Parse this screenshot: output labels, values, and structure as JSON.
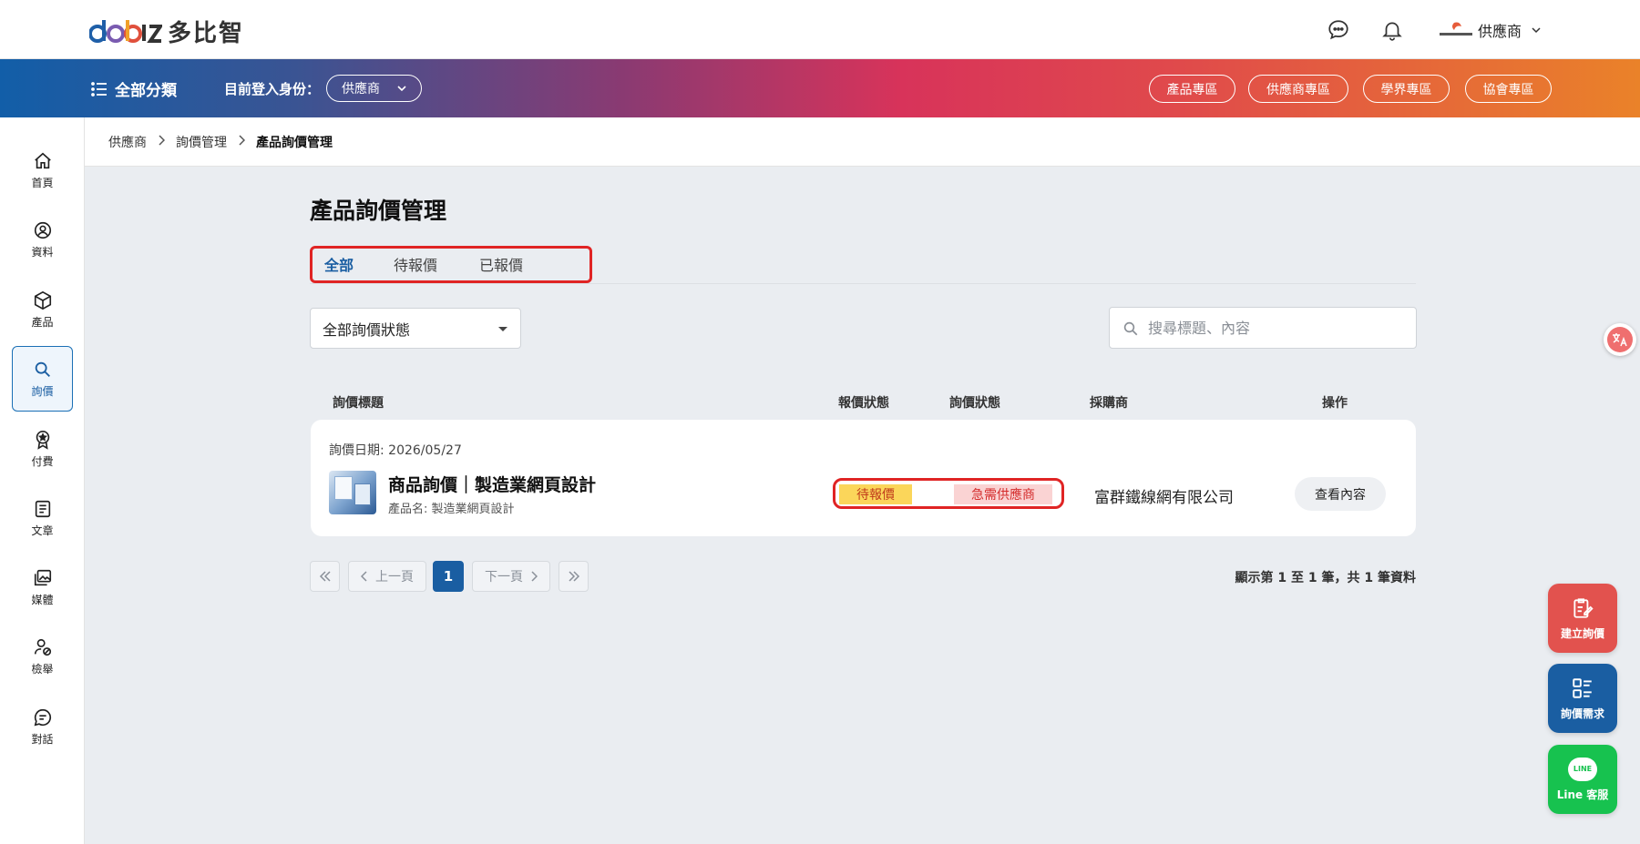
{
  "header": {
    "brand_text": "多比智",
    "user_name": "供應商"
  },
  "nav": {
    "all_categories": "全部分類",
    "role_label": "目前登入身份：",
    "role_value": "供應商",
    "zones": [
      "產品專區",
      "供應商專區",
      "學界專區",
      "協會專區"
    ]
  },
  "sidebar": {
    "items": [
      {
        "label": "首頁",
        "icon": "home-icon"
      },
      {
        "label": "資料",
        "icon": "user-circle-icon"
      },
      {
        "label": "產品",
        "icon": "box-icon"
      },
      {
        "label": "詢價",
        "icon": "search-icon"
      },
      {
        "label": "付費",
        "icon": "badge-icon"
      },
      {
        "label": "文章",
        "icon": "document-icon"
      },
      {
        "label": "媒體",
        "icon": "media-icon"
      },
      {
        "label": "檢舉",
        "icon": "report-user-icon"
      },
      {
        "label": "對話",
        "icon": "chat-icon"
      }
    ],
    "active_index": 3
  },
  "breadcrumb": {
    "items": [
      "供應商",
      "詢價管理",
      "產品詢價管理"
    ]
  },
  "main": {
    "title": "產品詢價管理",
    "tabs": [
      "全部",
      "待報價",
      "已報價"
    ],
    "filter_value": "全部詢價狀態",
    "search_placeholder": "搜尋標題、內容",
    "columns": [
      "詢價標題",
      "報價狀態",
      "詢價狀態",
      "採購商",
      "操作"
    ],
    "rows": [
      {
        "date": "詢價日期: 2026/05/27",
        "title": "商品詢價｜製造業網頁設計",
        "product": "產品名: 製造業網頁設計",
        "quote_status": "待報價",
        "inquiry_status": "急需供應商",
        "buyer": "富群鐵線網有限公司",
        "action": "查看內容"
      }
    ],
    "pager": {
      "prev": "上一頁",
      "next": "下一頁",
      "current": "1",
      "info": "顯示第 1 至 1 筆，共 1 筆資料"
    }
  },
  "floating": {
    "create_inquiry": "建立詢價",
    "inquiry_needs": "詢價需求",
    "line_service": "Line 客服",
    "line_logo": "LINE"
  },
  "colors": {
    "primary": "#1a5ea2",
    "highlight_red": "#e02424",
    "badge_yellow": "#fbd65a",
    "badge_pink": "#fad3d3"
  }
}
